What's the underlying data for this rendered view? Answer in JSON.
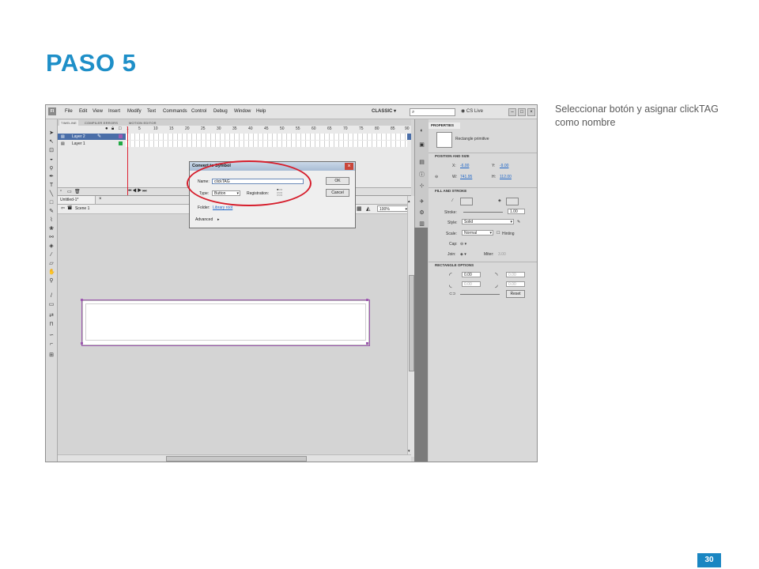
{
  "slide": {
    "title": "PASO 5",
    "instruction": "Seleccionar botón y asignar clickTAG como nombre",
    "page_number": "30"
  },
  "menu": {
    "logo": "Fl",
    "items": [
      "File",
      "Edit",
      "View",
      "Insert",
      "Modify",
      "Text",
      "Commands",
      "Control",
      "Debug",
      "Window",
      "Help"
    ],
    "workspace": "CLASSIC",
    "cs_live": "CS Live"
  },
  "timeline": {
    "tabs": [
      "TIMELINE",
      "COMPILER ERRORS",
      "MOTION EDITOR"
    ],
    "frame_numbers": [
      "1",
      "5",
      "10",
      "15",
      "20",
      "25",
      "30",
      "35",
      "40",
      "45",
      "50",
      "55",
      "60",
      "65",
      "70",
      "75",
      "80",
      "85",
      "90"
    ],
    "layers": [
      "Layer 2",
      "Layer 1"
    ],
    "accent": "#6a8ab8"
  },
  "document": {
    "tab": "Untitled-1*",
    "scene": "Scene 1",
    "zoom": "100%"
  },
  "dialog": {
    "title": "Convert to Symbol",
    "name_label": "Name:",
    "name_value": "clickTAG",
    "type_label": "Type:",
    "type_value": "Button",
    "registration_label": "Registration:",
    "folder_label": "Folder:",
    "folder_value": "Library root",
    "advanced": "Advanced",
    "ok": "OK",
    "cancel": "Cancel",
    "highlight_color": "#d61e2c"
  },
  "properties": {
    "tab": "PROPERTIES",
    "object": "Rectangle primitive",
    "position_section": "POSITION AND SIZE",
    "x_label": "X:",
    "x_value": "-6.00",
    "y_label": "Y:",
    "y_value": "-9.00",
    "w_label": "W:",
    "w_value": "741.95",
    "h_label": "H:",
    "h_value": "112.00",
    "fill_section": "FILL AND STROKE",
    "stroke_label": "Stroke:",
    "stroke_value": "1.00",
    "style_label": "Style:",
    "style_value": "Solid",
    "scale_label": "Scale:",
    "scale_value": "Normal",
    "hinting": "Hinting",
    "cap_label": "Cap:",
    "join_label": "Join:",
    "miter_label": "Miter:",
    "miter_value": "3.00",
    "rect_section": "RECTANGLE OPTIONS",
    "corner_values": [
      "0.00",
      "0.00",
      "0.00",
      "0.00"
    ],
    "reset": "Reset"
  },
  "colors": {
    "title_blue": "#1e8fc8",
    "selection_purple": "#9e5ab0"
  }
}
